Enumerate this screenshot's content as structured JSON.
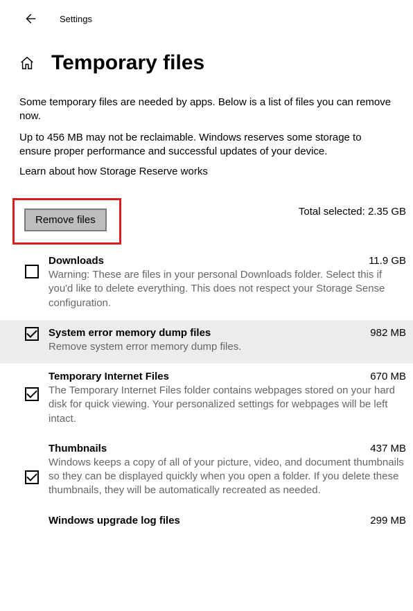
{
  "header": {
    "back_label": "Back",
    "title": "Settings"
  },
  "page": {
    "title": "Temporary files",
    "intro1": "Some temporary files are needed by apps. Below is a list of files you can remove now.",
    "intro2": "Up to 456 MB may not be reclaimable. Windows reserves some storage to ensure proper performance and successful updates of your device.",
    "link": "Learn about how Storage Reserve works",
    "remove_btn": "Remove files",
    "total_label": "Total selected: 2.35 GB"
  },
  "items": [
    {
      "title": "Downloads",
      "size": "11.9 GB",
      "desc": "Warning: These are files in your personal Downloads folder. Select this if you'd like to delete everything. This does not respect your Storage Sense configuration.",
      "checked": false,
      "selected": false
    },
    {
      "title": "System error memory dump files",
      "size": "982 MB",
      "desc": "Remove system error memory dump files.",
      "checked": true,
      "selected": true
    },
    {
      "title": "Temporary Internet Files",
      "size": "670 MB",
      "desc": "The Temporary Internet Files folder contains webpages stored on your hard disk for quick viewing. Your personalized settings for webpages will be left intact.",
      "checked": true,
      "selected": false
    },
    {
      "title": "Thumbnails",
      "size": "437 MB",
      "desc": "Windows keeps a copy of all of your picture, video, and document thumbnails so they can be displayed quickly when you open a folder. If you delete these thumbnails, they will be automatically recreated as needed.",
      "checked": true,
      "selected": false
    },
    {
      "title": "Windows upgrade log files",
      "size": "299 MB",
      "desc": "",
      "checked": false,
      "selected": false
    }
  ]
}
